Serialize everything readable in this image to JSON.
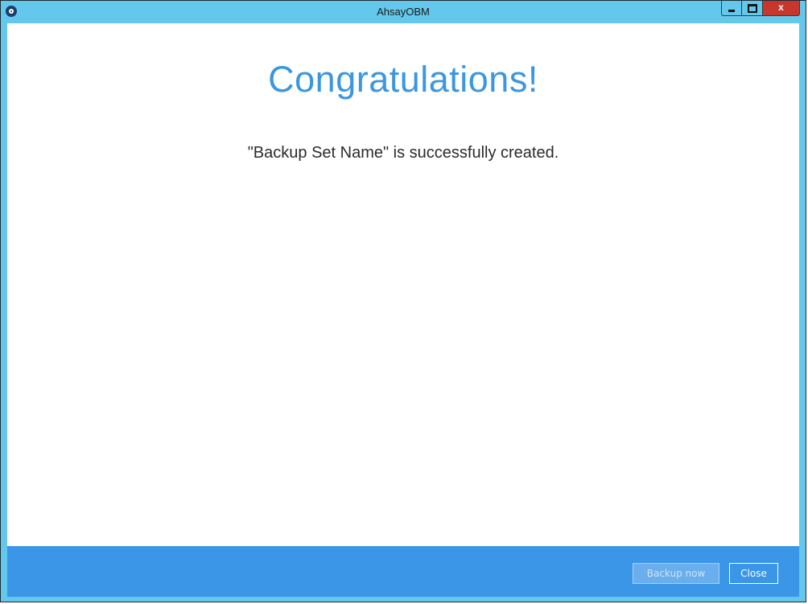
{
  "window": {
    "title": "AhsayOBM",
    "app_icon": "ahsay-logo-icon",
    "controls": {
      "minimize_icon": "minimize-icon",
      "maximize_icon": "maximize-icon",
      "close_glyph": "x"
    }
  },
  "main": {
    "heading": "Congratulations!",
    "message": "\"Backup Set Name\" is successfully created."
  },
  "footer": {
    "backup_now_label": "Backup now",
    "backup_now_enabled": false,
    "close_label": "Close"
  },
  "colors": {
    "titlebar": "#63c8ec",
    "accent": "#3b97e0",
    "footer": "#3b96e8",
    "close_button": "#c7372d"
  }
}
